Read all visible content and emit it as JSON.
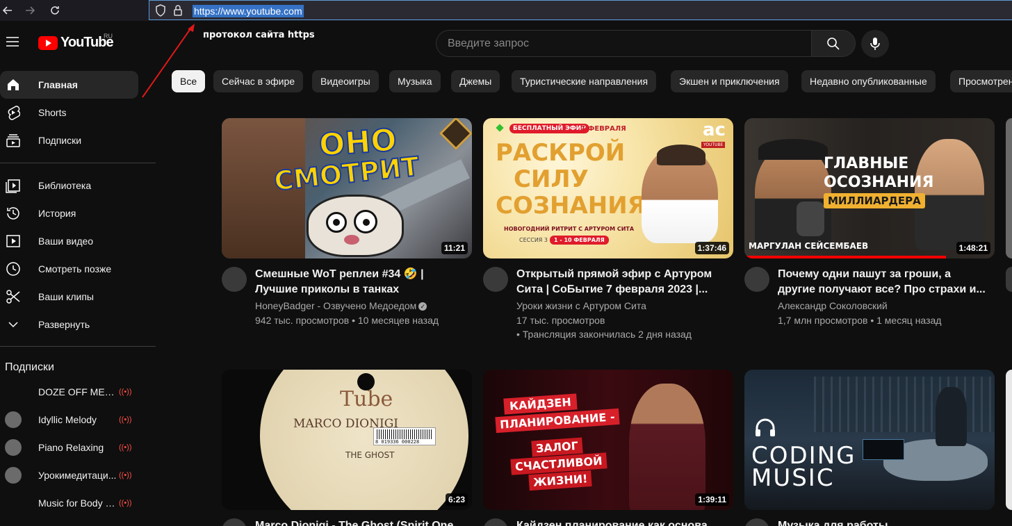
{
  "browser": {
    "url": "https://www.youtube.com"
  },
  "annotation": {
    "text": "протокол сайта https"
  },
  "masthead": {
    "logo_text": "YouTube",
    "region": "RU",
    "search_placeholder": "Введите запрос"
  },
  "sidebar": {
    "main": [
      {
        "label": "Главная",
        "icon": "home-icon"
      },
      {
        "label": "Shorts",
        "icon": "shorts-icon"
      },
      {
        "label": "Подписки",
        "icon": "subscriptions-icon"
      }
    ],
    "library": [
      {
        "label": "Библиотека",
        "icon": "library-icon"
      },
      {
        "label": "История",
        "icon": "history-icon"
      },
      {
        "label": "Ваши видео",
        "icon": "your-videos-icon"
      },
      {
        "label": "Смотреть позже",
        "icon": "watch-later-icon"
      },
      {
        "label": "Ваши клипы",
        "icon": "clips-icon"
      },
      {
        "label": "Развернуть",
        "icon": "chevron-down-icon"
      }
    ],
    "subscriptions_title": "Подписки",
    "subscriptions": [
      {
        "label": "DOZE OFF MEDU...",
        "live": "((•))"
      },
      {
        "label": "Idyllic Melody",
        "live": "((•))"
      },
      {
        "label": "Piano Relaxing",
        "live": "((•))"
      },
      {
        "label": "Урокимедитаци...",
        "live": "((•))"
      },
      {
        "label": "Music for Body a...",
        "live": "((•))"
      }
    ]
  },
  "chips": [
    "Все",
    "Сейчас в эфире",
    "Видеоигры",
    "Музыка",
    "Джемы",
    "Туристические направления",
    "Экшен и приключения",
    "Недавно опубликованные",
    "Просмотрено"
  ],
  "videos": [
    {
      "title": "Смешные WoT реплеи #34 🤣 | Лучшие приколы в танках",
      "channel": "HoneyBadger - Озвучено Медоедом",
      "meta": "942 тыс. просмотров • 10 месяцев назад",
      "meta2": "",
      "duration": "11:21",
      "thumb_text_1": "ОНО",
      "thumb_text_2": "СМОТРИТ"
    },
    {
      "title": "Открытый прямой эфир с Артуром Сита | СоБытие 7 февраля 2023 |...",
      "channel": "Уроки жизни с Артуром Сита",
      "meta": "17 тыс. просмотров",
      "meta2": "• Трансляция закончилась 2 дня назад",
      "duration": "1:37:46",
      "thumb_badge": "БЕСПЛАТНЫЙ ЭФИР",
      "thumb_date": "7 ФЕВРАЛЯ",
      "thumb_text_1": "РАСКРОЙ",
      "thumb_text_2": "СИЛУ",
      "thumb_text_3": "СОЗНАНИЯ",
      "thumb_sub": "НОВОГОДНИЙ РИТРИТ С АРТУРОМ СИТА",
      "thumb_session": "СЕССИЯ 3",
      "thumb_dates": "1 - 10 ФЕВРАЛЯ",
      "thumb_logo": "ac",
      "thumb_logo_sub": "YOUTUBE"
    },
    {
      "title": "Почему одни пашут за гроши, а другие получают все? Про страхи и...",
      "channel": "Александр Соколовский",
      "meta": "1,7 млн просмотров • 1 месяц назад",
      "meta2": "",
      "duration": "1:48:21",
      "thumb_text_1": "ГЛАВНЫЕ",
      "thumb_text_2": "ОСОЗНАНИЯ",
      "thumb_text_3": "МИЛЛИАРДЕРА",
      "thumb_caption": "МАРГУЛАН СЕЙСЕМБАЕВ"
    },
    {
      "title": "Marco Dionigi - The Ghost (Spirit One...",
      "duration": "6:23",
      "thumb_label_brand": "Tube",
      "thumb_label_artist": "MARCO DIONIGI",
      "thumb_label_track": "THE GHOST",
      "thumb_label_barcode": "8 019336 000228"
    },
    {
      "title": "Кайдзен планирование как основа...",
      "duration": "1:39:11",
      "thumb_text_1": "КАЙДЗЕН",
      "thumb_text_2": "ПЛАНИРОВАНИЕ -",
      "thumb_text_3": "ЗАЛОГ",
      "thumb_text_4": "СЧАСТЛИВОЙ",
      "thumb_text_5": "ЖИЗНИ!"
    },
    {
      "title": "Музыка для работы...",
      "thumb_text_1": "CODING",
      "thumb_text_2": "MUSIC"
    }
  ],
  "colors": {
    "background": "#0f0f0f",
    "chip": "#272727",
    "accent_red": "#ff0000",
    "secondary_text": "#aaaaaa"
  }
}
